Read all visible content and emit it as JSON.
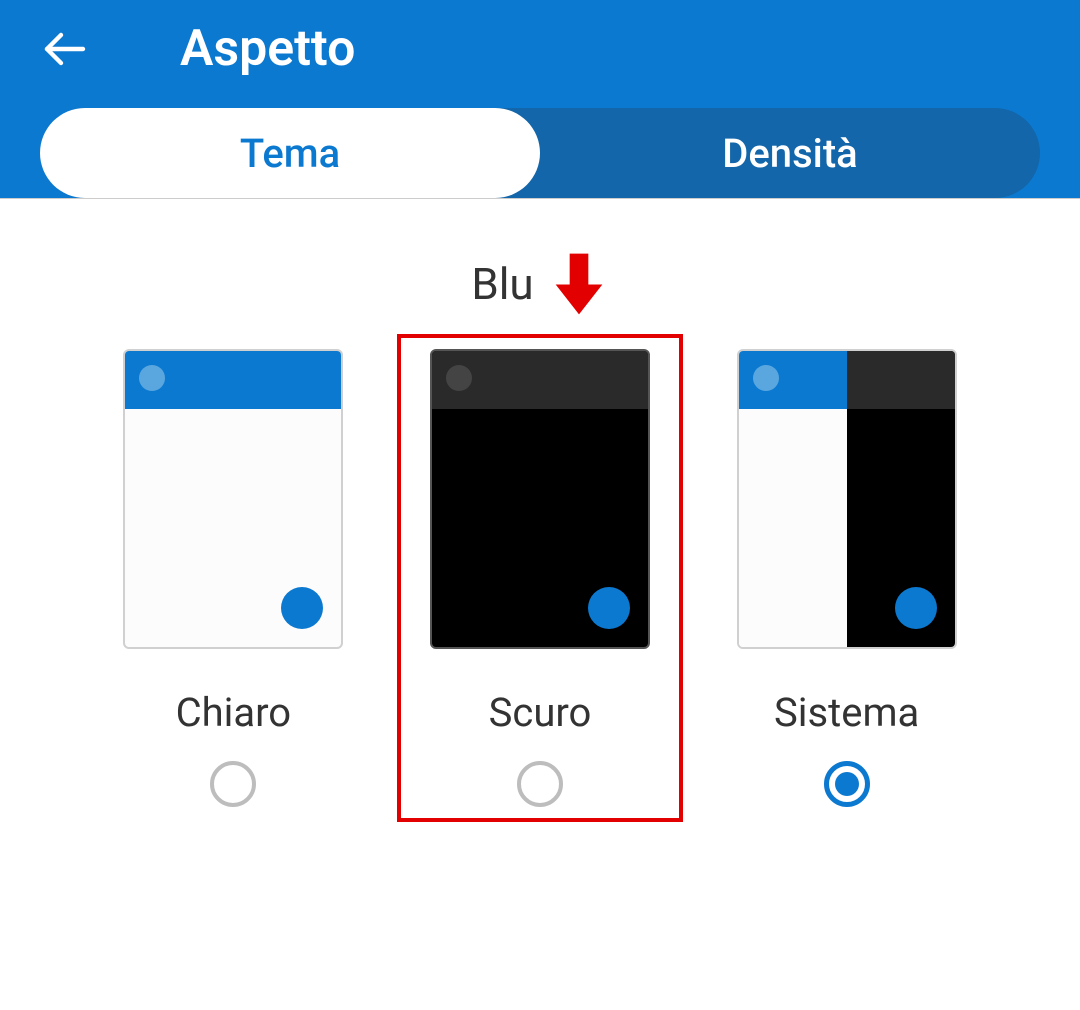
{
  "header": {
    "title": "Aspetto"
  },
  "tabs": [
    {
      "label": "Tema",
      "active": true
    },
    {
      "label": "Densità",
      "active": false
    }
  ],
  "section": {
    "title": "Blu"
  },
  "themes": [
    {
      "label": "Chiaro",
      "selected": false,
      "highlighted": false,
      "type": "light"
    },
    {
      "label": "Scuro",
      "selected": false,
      "highlighted": true,
      "type": "dark"
    },
    {
      "label": "Sistema",
      "selected": true,
      "highlighted": false,
      "type": "system"
    }
  ],
  "colors": {
    "primary": "#0c79d0",
    "header_dark": "#1266a9",
    "highlight": "#e30000"
  }
}
